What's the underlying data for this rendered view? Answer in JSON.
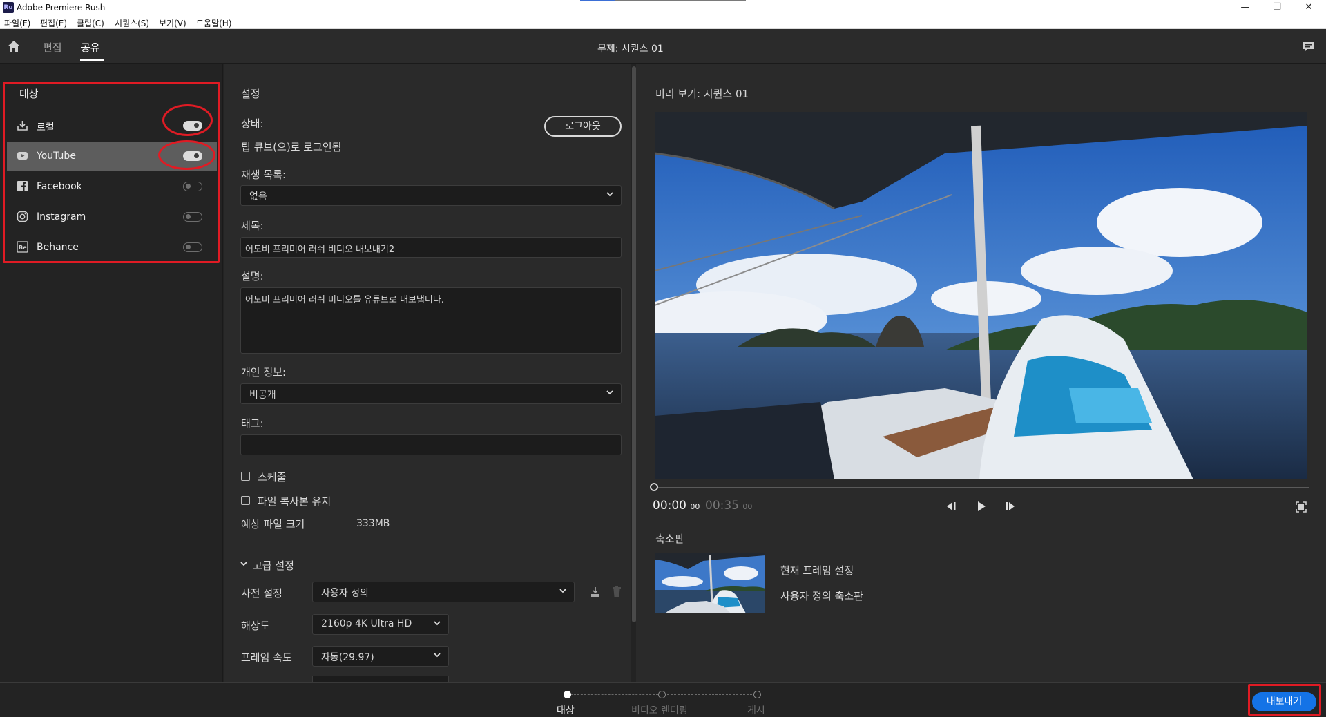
{
  "window": {
    "app_icon": "Ru",
    "title": "Adobe Premiere Rush",
    "controls": [
      "—",
      "❐",
      "✕"
    ]
  },
  "menu": [
    "파일(F)",
    "편집(E)",
    "클립(C)",
    "시퀀스(S)",
    "보기(V)",
    "도움말(H)"
  ],
  "header": {
    "tabs": [
      {
        "label": "편집",
        "active": false
      },
      {
        "label": "공유",
        "active": true
      }
    ],
    "sequence_title": "무제: 시퀀스 01"
  },
  "destinations": {
    "header": "대상",
    "items": [
      {
        "label": "로컬",
        "icon": "download-icon",
        "enabled": true,
        "selected": false
      },
      {
        "label": "YouTube",
        "icon": "youtube-icon",
        "enabled": true,
        "selected": true
      },
      {
        "label": "Facebook",
        "icon": "facebook-icon",
        "enabled": false,
        "selected": false
      },
      {
        "label": "Instagram",
        "icon": "instagram-icon",
        "enabled": false,
        "selected": false
      },
      {
        "label": "Behance",
        "icon": "behance-icon",
        "enabled": false,
        "selected": false
      }
    ]
  },
  "settings": {
    "header": "설정",
    "status_label": "상태:",
    "status_value": "팁 큐브(으)로 로그인됨",
    "logout_label": "로그아웃",
    "playlist_label": "재생 목록:",
    "playlist_value": "없음",
    "title_label": "제목:",
    "title_value": "어도비 프리미어 러쉬 비디오 내보내기2",
    "description_label": "설명:",
    "description_value": "어도비 프리미어 러쉬 비디오를 유튜브로 내보냅니다.",
    "privacy_label": "개인 정보:",
    "privacy_value": "비공개",
    "tags_label": "태그:",
    "tags_value": "",
    "schedule_label": "스케줄",
    "schedule_checked": false,
    "keep_copy_label": "파일 복사본 유지",
    "keep_copy_checked": false,
    "filesize_label": "예상 파일 크기",
    "filesize_value": "333MB",
    "advanced_label": "고급 설정",
    "preset_label": "사전 설정",
    "preset_value": "사용자 정의",
    "resolution_label": "해상도",
    "resolution_value": "2160p 4K Ultra HD",
    "framerate_label": "프레임 속도",
    "framerate_value": "자동(29.97)"
  },
  "preview": {
    "header": "미리 보기: 시퀀스 01",
    "current_time": "00:00",
    "current_frames": "00",
    "total_time": "00:35",
    "total_frames": "00",
    "playhead_fraction": 0,
    "thumbnail_label": "축소판",
    "thumb_option_1": "현재 프레임 설정",
    "thumb_option_2": "사용자 정의 축소판"
  },
  "steps": [
    {
      "label": "대상",
      "active": true
    },
    {
      "label": "비디오 렌더링",
      "active": false
    },
    {
      "label": "게시",
      "active": false
    }
  ],
  "export_label": "내보내기",
  "colors": {
    "accent": "#1473e6",
    "annotation_red": "#e01b24",
    "panel_bg": "#2a2a2a",
    "selected_item_bg": "#5d5d5d"
  }
}
